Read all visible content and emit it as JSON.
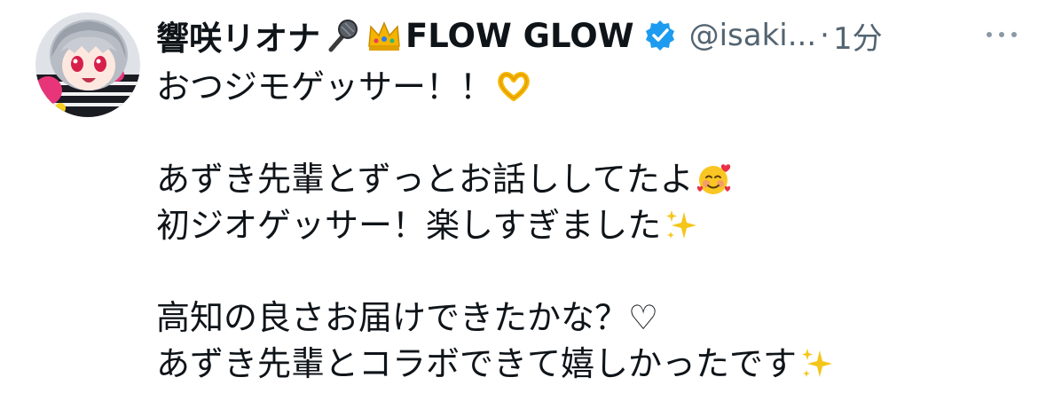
{
  "tweet": {
    "author": {
      "name_part1": "響咲リオナ",
      "name_part2": "FLOW GLOW",
      "handle": "@isaki...",
      "separator": "·",
      "time": "1分",
      "icons": [
        "microphone-icon",
        "crown-icon",
        "verified-badge-icon"
      ]
    },
    "more_icon": "more-options-icon",
    "lines": [
      {
        "text": "おつジモゲッサー！！",
        "emoji": "heart-hands-emoji"
      },
      {
        "text": "",
        "emoji": ""
      },
      {
        "text": "あずき先輩とずっとお話ししてたよ",
        "emoji": "smiling-face-with-hearts-emoji"
      },
      {
        "text": "初ジオゲッサー！楽しすぎました",
        "emoji": "sparkles-emoji"
      },
      {
        "text": "",
        "emoji": ""
      },
      {
        "text": "高知の良さお届けできたかな？♡",
        "emoji": ""
      },
      {
        "text": "あずき先輩とコラボできて嬉しかったです",
        "emoji": "sparkles-emoji"
      }
    ]
  },
  "colors": {
    "text_primary": "#0f1419",
    "text_secondary": "#536471",
    "verified_blue": "#1d9bf0"
  }
}
